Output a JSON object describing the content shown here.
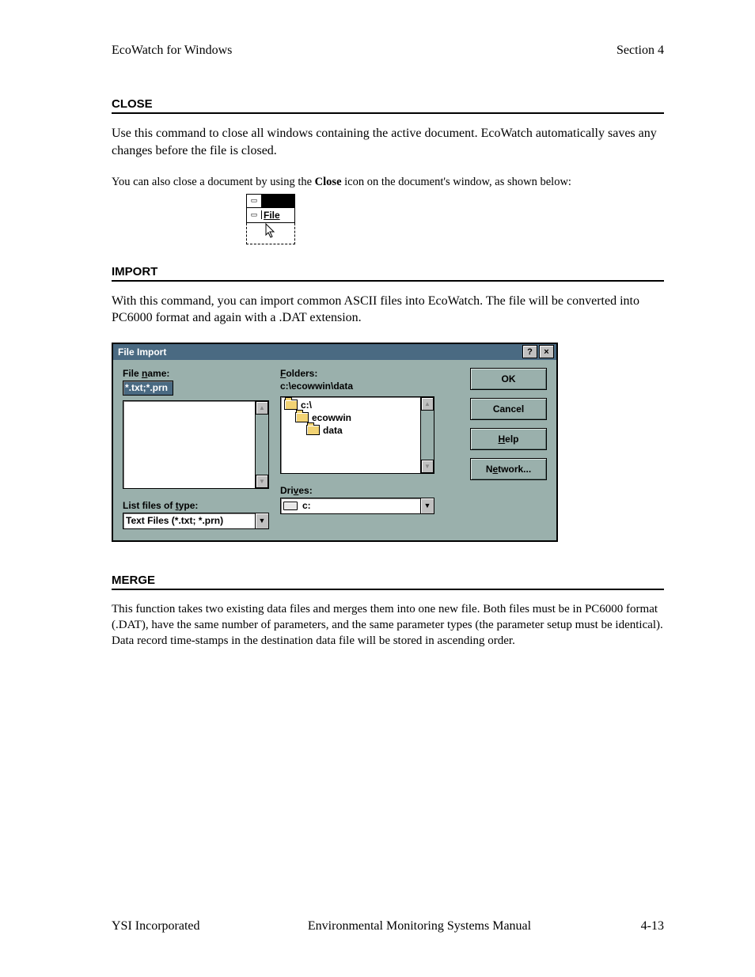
{
  "header": {
    "left": "EcoWatch for Windows",
    "right": "Section 4"
  },
  "sections": {
    "close": {
      "title": "CLOSE",
      "para1": "Use this command to close all windows containing the active document.  EcoWatch automatically saves any changes before the file is closed.",
      "para2a": "You can also close a document by using the ",
      "para2b": "Close",
      "para2c": " icon on the document's window, as shown below:",
      "menu_label": "File"
    },
    "import": {
      "title": "IMPORT",
      "para": "With this command, you can import common ASCII files into EcoWatch. The file will be converted into PC6000 format and again with a .DAT extension."
    },
    "merge": {
      "title": "MERGE",
      "para": "This function takes two existing data files and merges them into one new file. Both files must be in PC6000 format (.DAT), have the same number of parameters, and the same parameter types (the parameter setup must be identical). Data record time-stamps in the destination data file will be stored in ascending order."
    }
  },
  "dialog": {
    "title": "File Import",
    "file_name_label_pre": "File ",
    "file_name_label_u": "n",
    "file_name_label_post": "ame:",
    "file_name_value": "*.txt;*.prn",
    "folders_label_u": "F",
    "folders_label": "olders:",
    "folders_path": "c:\\ecowwin\\data",
    "folder_tree": [
      "c:\\",
      "ecowwin",
      "data"
    ],
    "list_type_label_pre": "List files of ",
    "list_type_label_u": "t",
    "list_type_label_post": "ype:",
    "list_type_value": "Text Files (*.txt; *.prn)",
    "drives_label_pre": "Dri",
    "drives_label_u": "v",
    "drives_label_post": "es:",
    "drives_value": "c:",
    "buttons": {
      "ok": "OK",
      "cancel": "Cancel",
      "help_u": "H",
      "help_rest": "elp",
      "network_pre": "N",
      "network_u": "e",
      "network_post": "twork..."
    }
  },
  "footer": {
    "left": "YSI Incorporated",
    "center": "Environmental Monitoring Systems Manual",
    "right": "4-13"
  }
}
